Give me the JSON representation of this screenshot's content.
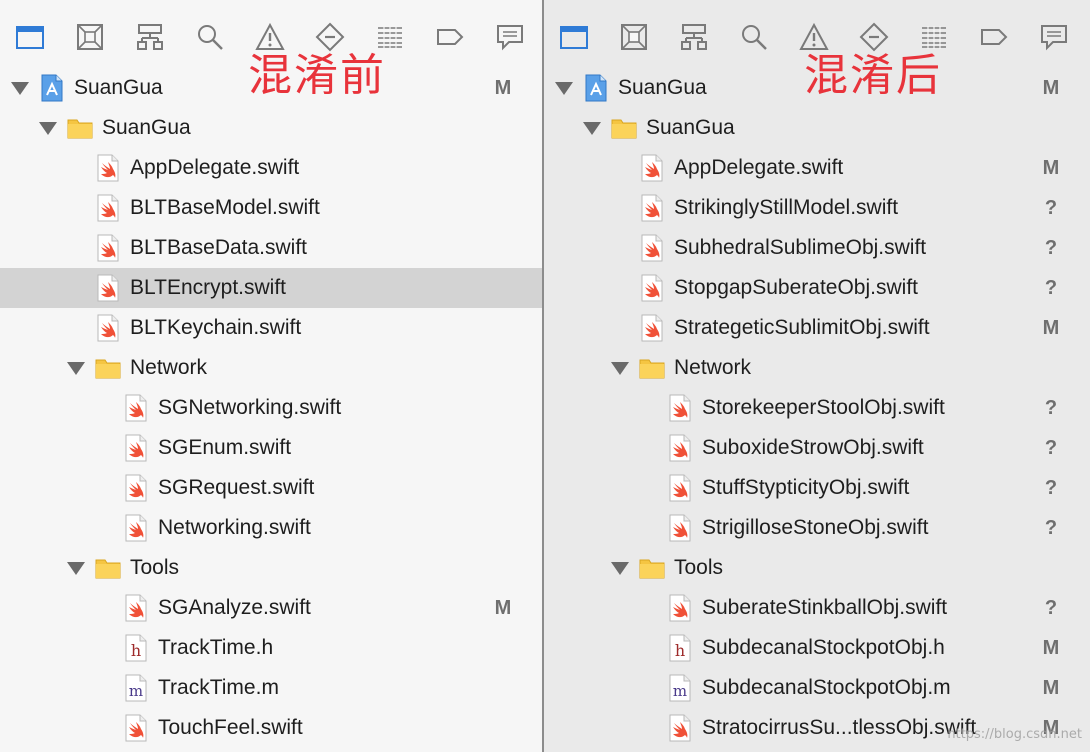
{
  "colors": {
    "accent_blue": "#2f7bd6",
    "annotation_red": "#e8333b",
    "status_gray": "#6f6f6f",
    "swift_orange": "#f05138"
  },
  "toolbar_icons": [
    "folder-icon",
    "source-control-icon",
    "hierarchy-icon",
    "search-icon",
    "warning-icon",
    "breakpoint-icon",
    "list-icon",
    "tag-icon",
    "comment-icon"
  ],
  "left": {
    "annotation": "混淆前",
    "rows": [
      {
        "label": "SuanGua",
        "icon": "project",
        "level": 0,
        "expanded": true,
        "status": "M"
      },
      {
        "label": "SuanGua",
        "icon": "folder",
        "level": 1,
        "expanded": true,
        "status": ""
      },
      {
        "label": "AppDelegate.swift",
        "icon": "swift",
        "level": 2,
        "status": ""
      },
      {
        "label": "BLTBaseModel.swift",
        "icon": "swift",
        "level": 2,
        "status": ""
      },
      {
        "label": "BLTBaseData.swift",
        "icon": "swift",
        "level": 2,
        "status": ""
      },
      {
        "label": "BLTEncrypt.swift",
        "icon": "swift",
        "level": 2,
        "status": "",
        "selected": true
      },
      {
        "label": "BLTKeychain.swift",
        "icon": "swift",
        "level": 2,
        "status": ""
      },
      {
        "label": "Network",
        "icon": "folder",
        "level": 2,
        "expanded": true,
        "status": ""
      },
      {
        "label": "SGNetworking.swift",
        "icon": "swift",
        "level": 3,
        "status": ""
      },
      {
        "label": "SGEnum.swift",
        "icon": "swift",
        "level": 3,
        "status": ""
      },
      {
        "label": "SGRequest.swift",
        "icon": "swift",
        "level": 3,
        "status": ""
      },
      {
        "label": "Networking.swift",
        "icon": "swift",
        "level": 3,
        "status": ""
      },
      {
        "label": "Tools",
        "icon": "folder",
        "level": 2,
        "expanded": true,
        "status": ""
      },
      {
        "label": "SGAnalyze.swift",
        "icon": "swift",
        "level": 3,
        "status": "M"
      },
      {
        "label": "TrackTime.h",
        "icon": "h",
        "level": 3,
        "status": ""
      },
      {
        "label": "TrackTime.m",
        "icon": "m",
        "level": 3,
        "status": ""
      },
      {
        "label": "TouchFeel.swift",
        "icon": "swift",
        "level": 3,
        "status": ""
      }
    ]
  },
  "right": {
    "annotation": "混淆后",
    "watermark": "https://blog.csdn.net",
    "rows": [
      {
        "label": "SuanGua",
        "icon": "project",
        "level": 0,
        "expanded": true,
        "status": "M"
      },
      {
        "label": "SuanGua",
        "icon": "folder",
        "level": 1,
        "expanded": true,
        "status": ""
      },
      {
        "label": "AppDelegate.swift",
        "icon": "swift",
        "level": 2,
        "status": "M"
      },
      {
        "label": "StrikinglyStillModel.swift",
        "icon": "swift",
        "level": 2,
        "status": "?"
      },
      {
        "label": "SubhedralSublimeObj.swift",
        "icon": "swift",
        "level": 2,
        "status": "?"
      },
      {
        "label": "StopgapSuberateObj.swift",
        "icon": "swift",
        "level": 2,
        "status": "?"
      },
      {
        "label": "StrategeticSublimitObj.swift",
        "icon": "swift",
        "level": 2,
        "status": "M"
      },
      {
        "label": "Network",
        "icon": "folder",
        "level": 2,
        "expanded": true,
        "status": ""
      },
      {
        "label": "StorekeeperStoolObj.swift",
        "icon": "swift",
        "level": 3,
        "status": "?"
      },
      {
        "label": "SuboxideStrowObj.swift",
        "icon": "swift",
        "level": 3,
        "status": "?"
      },
      {
        "label": "StuffStypticityObj.swift",
        "icon": "swift",
        "level": 3,
        "status": "?"
      },
      {
        "label": "StrigilloseStoneObj.swift",
        "icon": "swift",
        "level": 3,
        "status": "?"
      },
      {
        "label": "Tools",
        "icon": "folder",
        "level": 2,
        "expanded": true,
        "status": ""
      },
      {
        "label": "SuberateStinkballObj.swift",
        "icon": "swift",
        "level": 3,
        "status": "?"
      },
      {
        "label": "SubdecanalStockpotObj.h",
        "icon": "h",
        "level": 3,
        "status": "M"
      },
      {
        "label": "SubdecanalStockpotObj.m",
        "icon": "m",
        "level": 3,
        "status": "M"
      },
      {
        "label": "StratocirrusSu...tlessObj.swift",
        "icon": "swift",
        "level": 3,
        "status": "M"
      }
    ]
  }
}
